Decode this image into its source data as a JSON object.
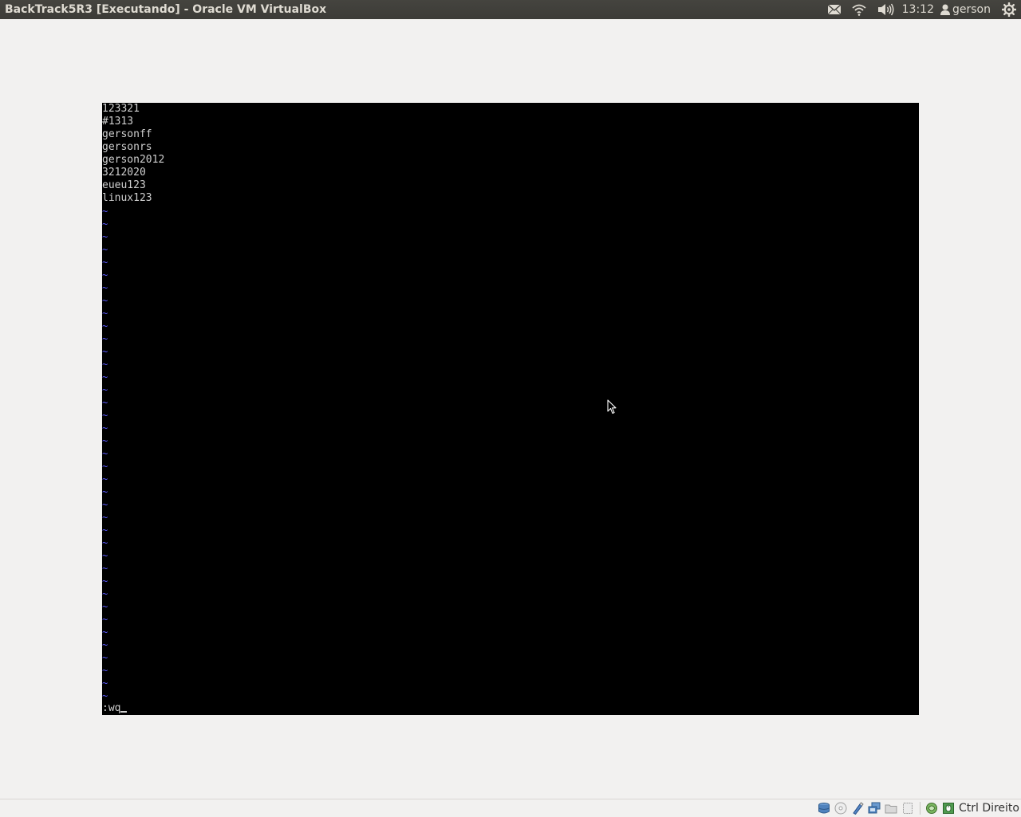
{
  "window": {
    "title": "BackTrack5R3 [Executando] - Oracle VM VirtualBox"
  },
  "panel": {
    "indicators": [
      "mail-icon",
      "wifi-icon",
      "volume-icon"
    ],
    "clock": "13:12",
    "user": "gerson",
    "session_icon": "gear-icon"
  },
  "terminal": {
    "lines": [
      "123321",
      "#1313",
      "gersonff",
      "gersonrs",
      "gerson2012",
      "3212020",
      "eueu123",
      "linux123"
    ],
    "empty_marker": "~",
    "command": ":wq"
  },
  "statusbar": {
    "icons": [
      "hard-disk-icon",
      "optical-disk-icon",
      "usb-icon",
      "network-icon",
      "shared-folder-icon",
      "video-capture-icon",
      "virtualization-icon",
      "mouse-integration-icon"
    ],
    "host_key": "Ctrl Direito"
  },
  "colors": {
    "panel_bg": "#3c3b37",
    "desktop_bg": "#f2f1f0",
    "terminal_bg": "#000000",
    "terminal_text": "#d0d0d0",
    "vim_tilde": "#5b5bff"
  }
}
